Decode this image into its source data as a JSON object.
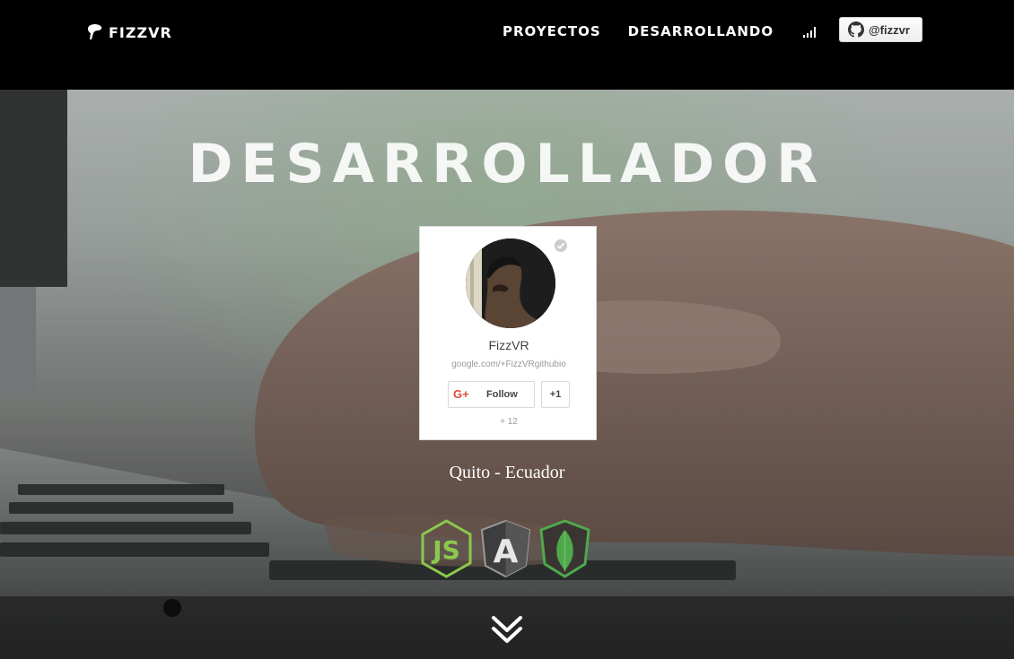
{
  "navbar": {
    "brand": "FIZZVR",
    "links": [
      "PROYECTOS",
      "DESARROLLANDO"
    ],
    "github_handle": "@fizzvr"
  },
  "hero": {
    "title": "DESARROLLADOR",
    "location": "Quito - Ecuador"
  },
  "gplus_card": {
    "name": "FizzVR",
    "url": "google.com/+FizzVRgithubio",
    "gplus_mark": "G+",
    "follow_label": "Follow",
    "plusone_label": "+1",
    "plus_count": "+ 12"
  },
  "tech": {
    "node_text": "JS",
    "angular_text": "A"
  },
  "icons": [
    "brand-logo-icon",
    "signal-icon",
    "github-icon",
    "verified-icon",
    "gplus-icon",
    "nodejs-icon",
    "angular-icon",
    "mongodb-icon",
    "chevron-double-down-icon"
  ],
  "colors": {
    "navbar_bg": "#000000",
    "node_green": "#8cc84b",
    "angular_gray": "#4a4a4a",
    "mongo_green": "#4fa94c",
    "gplus_red": "#dd4b39"
  }
}
